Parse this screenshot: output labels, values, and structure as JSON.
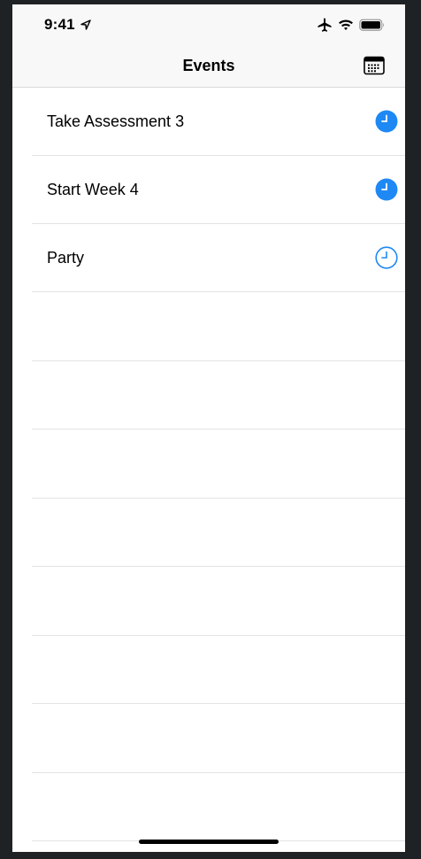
{
  "status_bar": {
    "time": "9:41",
    "icons": [
      "location-arrow-icon",
      "airplane-icon",
      "wifi-icon",
      "battery-icon"
    ]
  },
  "nav": {
    "title": "Events",
    "right_icon": "calendar-icon"
  },
  "events": [
    {
      "title": "Take Assessment 3",
      "icon": "clock-filled-icon"
    },
    {
      "title": "Start Week 4",
      "icon": "clock-filled-icon"
    },
    {
      "title": "Party",
      "icon": "clock-outline-icon"
    }
  ],
  "colors": {
    "accent": "#1e88f4",
    "nav_background": "#f8f8f8",
    "separator": "#e3e3e6"
  }
}
